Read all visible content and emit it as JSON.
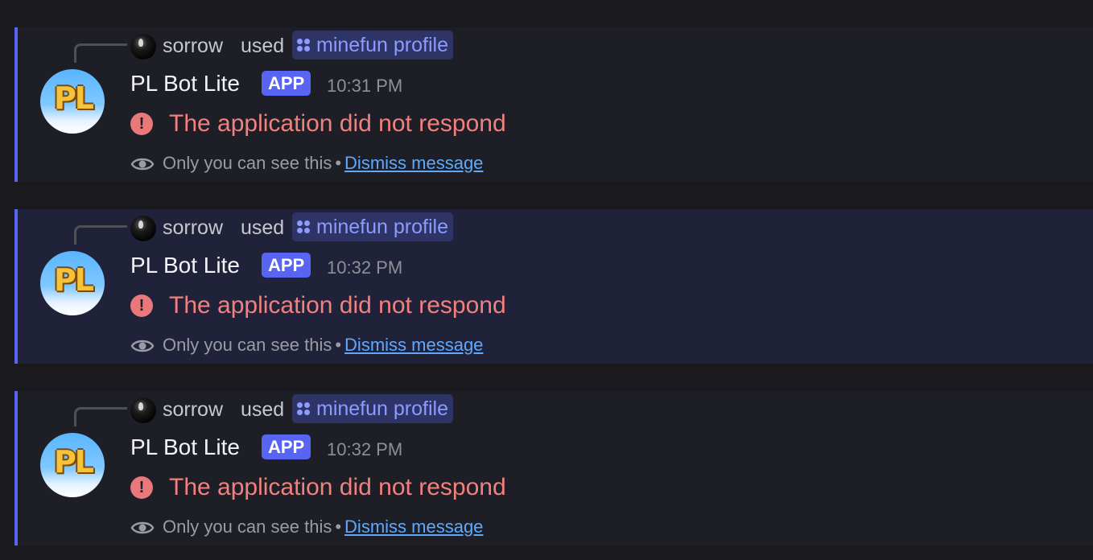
{
  "accent_color": "#5865f2",
  "messages": [
    {
      "reply_user": "sorrow",
      "reply_verb": "used",
      "command": "minefun profile",
      "bot_name": "PL Bot Lite",
      "badge": "APP",
      "time": "10:31 PM",
      "error": "The application did not respond",
      "ephemeral_note": "Only you can see this",
      "separator": "•",
      "dismiss": "Dismiss message",
      "avatar_text": "PL",
      "icons": {
        "reply_avatar": "user-avatar-icon",
        "command": "slash-command-icon",
        "alert": "exclamation-circle-icon",
        "eye": "eye-icon"
      }
    },
    {
      "reply_user": "sorrow",
      "reply_verb": "used",
      "command": "minefun profile",
      "bot_name": "PL Bot Lite",
      "badge": "APP",
      "time": "10:32 PM",
      "error": "The application did not respond",
      "ephemeral_note": "Only you can see this",
      "separator": "•",
      "dismiss": "Dismiss message",
      "avatar_text": "PL",
      "icons": {
        "reply_avatar": "user-avatar-icon",
        "command": "slash-command-icon",
        "alert": "exclamation-circle-icon",
        "eye": "eye-icon"
      }
    },
    {
      "reply_user": "sorrow",
      "reply_verb": "used",
      "command": "minefun profile",
      "bot_name": "PL Bot Lite",
      "badge": "APP",
      "time": "10:32 PM",
      "error": "The application did not respond",
      "ephemeral_note": "Only you can see this",
      "separator": "•",
      "dismiss": "Dismiss message",
      "avatar_text": "PL",
      "icons": {
        "reply_avatar": "user-avatar-icon",
        "command": "slash-command-icon",
        "alert": "exclamation-circle-icon",
        "eye": "eye-icon"
      }
    }
  ]
}
